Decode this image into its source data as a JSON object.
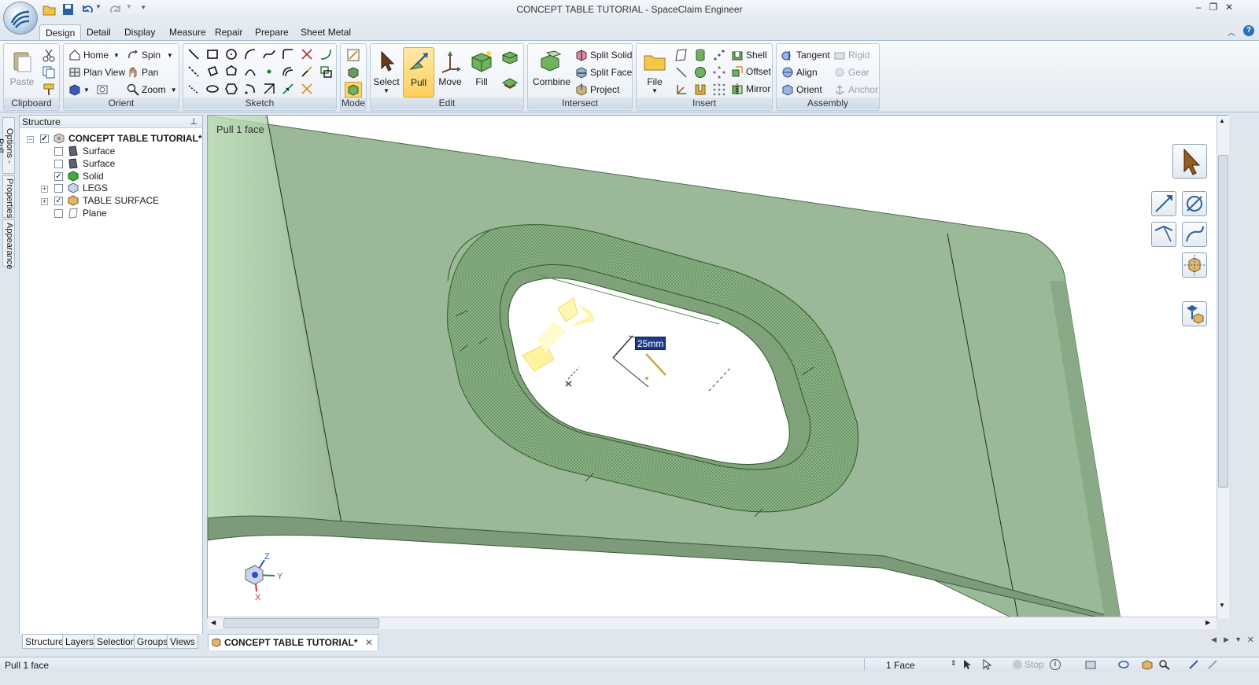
{
  "window": {
    "title": "CONCEPT TABLE TUTORIAL - SpaceClaim Engineer"
  },
  "ribbon": {
    "tabs": [
      "Design",
      "Detail",
      "Display",
      "Measure",
      "Repair",
      "Prepare",
      "Sheet Metal"
    ],
    "groups": {
      "clipboard": {
        "label": "Clipboard",
        "paste": "Paste"
      },
      "orient": {
        "label": "Orient",
        "home": "Home",
        "spin": "Spin",
        "plan_view": "Plan View",
        "pan": "Pan",
        "zoom": "Zoom"
      },
      "sketch": {
        "label": "Sketch"
      },
      "mode": {
        "label": "Mode"
      },
      "edit": {
        "label": "Edit",
        "select": "Select",
        "pull": "Pull",
        "move": "Move",
        "fill": "Fill"
      },
      "intersect": {
        "label": "Intersect",
        "combine": "Combine",
        "split_solid": "Split Solid",
        "split_face": "Split Face",
        "project": "Project"
      },
      "insert": {
        "label": "Insert",
        "file": "File",
        "shell": "Shell",
        "offset": "Offset",
        "mirror": "Mirror"
      },
      "assembly": {
        "label": "Assembly",
        "tangent": "Tangent",
        "align": "Align",
        "orient": "Orient",
        "rigid": "Rigid",
        "gear": "Gear",
        "anchor": "Anchor"
      }
    }
  },
  "side_tabs": [
    "Options - Pull",
    "Properties",
    "Appearance"
  ],
  "structure": {
    "title": "Structure",
    "root": "CONCEPT TABLE TUTORIAL*",
    "items": [
      {
        "label": "Surface",
        "checked": false
      },
      {
        "label": "Surface",
        "checked": false
      },
      {
        "label": "Solid",
        "checked": true
      },
      {
        "label": "LEGS",
        "checked": false
      },
      {
        "label": "TABLE SURFACE",
        "checked": true
      },
      {
        "label": "Plane",
        "checked": false
      }
    ],
    "panel_tabs": [
      "Structure",
      "Layers",
      "Selection",
      "Groups",
      "Views"
    ]
  },
  "viewport": {
    "label": "Pull 1 face",
    "dimension": "25mm",
    "axes": {
      "z": "Z",
      "y": "Y",
      "x": "X"
    },
    "model_color": "#9bb898"
  },
  "document_tab": "CONCEPT TABLE TUTORIAL*",
  "status": {
    "left": "Pull 1 face",
    "selection": "1 Face",
    "stop": "Stop"
  }
}
